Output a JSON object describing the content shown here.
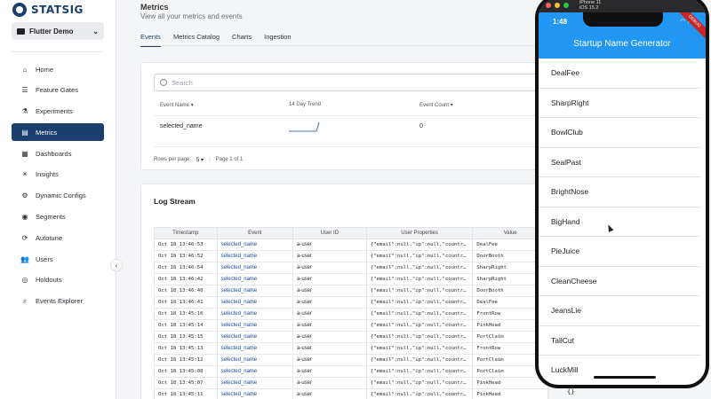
{
  "brand": {
    "name": "STATSIG"
  },
  "project": {
    "name": "Flutter Demo"
  },
  "sidebar": {
    "items": [
      {
        "label": "Home",
        "icon": "home-icon",
        "glyph": "⌂"
      },
      {
        "label": "Feature Gates",
        "icon": "toggle-icon",
        "glyph": "☰"
      },
      {
        "label": "Experiments",
        "icon": "flask-icon",
        "glyph": "⚗"
      },
      {
        "label": "Metrics",
        "icon": "bar-chart-icon",
        "glyph": "▤",
        "active": true
      },
      {
        "label": "Dashboards",
        "icon": "dashboard-icon",
        "glyph": "▦"
      },
      {
        "label": "Insights",
        "icon": "insights-icon",
        "glyph": "✳"
      },
      {
        "label": "Dynamic Configs",
        "icon": "config-icon",
        "glyph": "⚙"
      },
      {
        "label": "Segments",
        "icon": "segments-icon",
        "glyph": "◉"
      },
      {
        "label": "Autotune",
        "icon": "autotune-icon",
        "glyph": "⟳"
      },
      {
        "label": "Users",
        "icon": "users-icon",
        "glyph": "👥"
      },
      {
        "label": "Holdouts",
        "icon": "holdouts-icon",
        "glyph": "◎"
      },
      {
        "label": "Events Explorer",
        "icon": "events-explorer-icon",
        "glyph": "⌕"
      }
    ]
  },
  "header": {
    "title": "Metrics",
    "subtitle": "View all your metrics and events",
    "tabs": [
      {
        "label": "Events",
        "active": true
      },
      {
        "label": "Metrics Catalog"
      },
      {
        "label": "Charts"
      },
      {
        "label": "Ingestion"
      }
    ]
  },
  "metrics_card": {
    "search_placeholder": "Search",
    "columns": {
      "name": "Event Name",
      "trend": "14 Day Trend",
      "count": "Event Count"
    },
    "row": {
      "name": "selected_name",
      "count": "0"
    },
    "footer": {
      "rows_label": "Rows per page:",
      "rows_value": "5",
      "page": "Page 1 of 1"
    }
  },
  "log_stream": {
    "title": "Log Stream",
    "columns": [
      "Timestamp",
      "Event",
      "User ID",
      "User Properties",
      "Value"
    ],
    "rows": [
      [
        "Oct 18 13:46:53",
        "selected_name",
        "a-user",
        "{\"email\":null,\"ip\":null,\"countr…",
        "DealFee"
      ],
      [
        "Oct 18 13:46:52",
        "selected_name",
        "a-user",
        "{\"email\":null,\"ip\":null,\"countr…",
        "DoorBooth"
      ],
      [
        "Oct 18 13:46:54",
        "selected_name",
        "a-user",
        "{\"email\":null,\"ip\":null,\"countr…",
        "SharpRight"
      ],
      [
        "Oct 18 13:46:42",
        "selected_name",
        "a-user",
        "{\"email\":null,\"ip\":null,\"countr…",
        "SharpRight"
      ],
      [
        "Oct 18 13:46:40",
        "selected_name",
        "a-user",
        "{\"email\":null,\"ip\":null,\"countr…",
        "DoorBooth"
      ],
      [
        "Oct 18 13:46:41",
        "selected_name",
        "a-user",
        "{\"email\":null,\"ip\":null,\"countr…",
        "DealFee"
      ],
      [
        "Oct 18 13:45:16",
        "selected_name",
        "a-user",
        "{\"email\":null,\"ip\":null,\"countr…",
        "FrontRow"
      ],
      [
        "Oct 18 13:45:14",
        "selected_name",
        "a-user",
        "{\"email\":null,\"ip\":null,\"countr…",
        "PinkHead"
      ],
      [
        "Oct 18 13:45:15",
        "selected_name",
        "a-user",
        "{\"email\":null,\"ip\":null,\"countr…",
        "PortClaim"
      ],
      [
        "Oct 18 13:45:13",
        "selected_name",
        "a-user",
        "{\"email\":null,\"ip\":null,\"countr…",
        "FrontRow"
      ],
      [
        "Oct 18 13:45:12",
        "selected_name",
        "a-user",
        "{\"email\":null,\"ip\":null,\"countr…",
        "PortClaim"
      ],
      [
        "Oct 18 13:45:08",
        "selected_name",
        "a-user",
        "{\"email\":null,\"ip\":null,\"countr…",
        "PortClaim"
      ],
      [
        "Oct 18 13:45:07",
        "selected_name",
        "a-user",
        "{\"email\":null,\"ip\":null,\"countr…",
        "PinkHead"
      ],
      [
        "Oct 18 13:45:11",
        "selected_name",
        "a-user",
        "{\"email\":null,\"ip\":null,\"countr…",
        "PinkHead"
      ]
    ]
  },
  "simulator": {
    "device": "iPhone 11",
    "os": "iOS 15.2",
    "time": "1:48",
    "debug_banner": "DEBUG",
    "app_title": "Startup Name Generator",
    "names": [
      "DealFee",
      "SharpRight",
      "BowlClub",
      "SealPast",
      "BrightNose",
      "BigHand",
      "PieJuice",
      "CleanCheese",
      "JeansLie",
      "TallCut",
      "LuckMill"
    ],
    "trailing_value": "{}"
  },
  "colors": {
    "accent": "#1a3f6f",
    "app_bar": "#2196f3",
    "link": "#1a4fa0"
  }
}
